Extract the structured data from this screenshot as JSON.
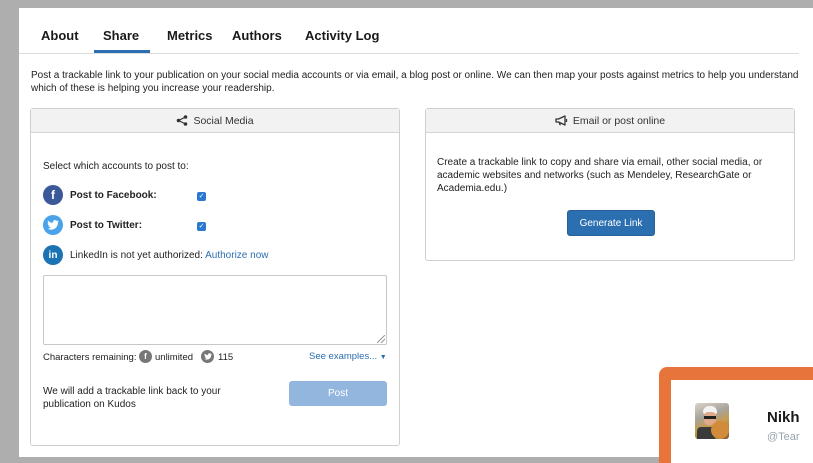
{
  "tabs": [
    {
      "label": "About"
    },
    {
      "label": "Share"
    },
    {
      "label": "Metrics"
    },
    {
      "label": "Authors"
    },
    {
      "label": "Activity Log"
    }
  ],
  "active_tab": "Share",
  "intro": "Post a trackable link to your publication on your social media accounts or via email, a blog post or online. We can then map your posts against metrics to help you understand which of these is helping you increase your readership.",
  "social": {
    "title": "Social Media",
    "select_label": "Select which accounts to post to:",
    "facebook_label": "Post to Facebook:",
    "facebook_checked": true,
    "twitter_label": "Post to Twitter:",
    "twitter_checked": true,
    "linkedin_text": "LinkedIn is not yet authorized:",
    "linkedin_link": "Authorize now",
    "message_value": "",
    "chars_label": "Characters remaining:",
    "facebook_remaining": "unlimited",
    "twitter_remaining": "115",
    "see_examples": "See examples...",
    "note": "We will add a trackable link back to your publication on Kudos",
    "post_button": "Post"
  },
  "email": {
    "title": "Email or post online",
    "text": "Create a trackable link to copy and share via email, other social media, or academic websites and networks (such as Mendeley, ResearchGate or Academia.edu.)",
    "button": "Generate Link"
  },
  "tweet": {
    "name": "Nikh",
    "handle": "@Tear"
  },
  "colors": {
    "accent": "#2c6fb0",
    "facebook": "#3b5998",
    "twitter": "#4aa3ea",
    "linkedin": "#1b73b3",
    "tweet_frame": "#e7743a"
  }
}
